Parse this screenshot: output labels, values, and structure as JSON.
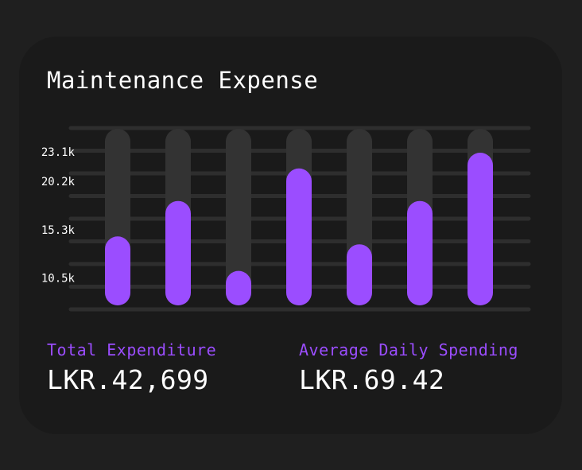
{
  "title": "Maintenance Expense",
  "stats": {
    "total_label": "Total Expenditure",
    "total_value": "LKR.42,699",
    "avg_label": "Average Daily Spending",
    "avg_value": "LKR.69.42"
  },
  "colors": {
    "accent": "#9b4dff",
    "track": "#333333",
    "grid": "#2e2e2e",
    "card": "#1a1a1a",
    "text": "#ffffff"
  },
  "chart_data": {
    "type": "bar",
    "categories": [
      "",
      "",
      "",
      "",
      "",
      "",
      ""
    ],
    "values": [
      15.6,
      19.2,
      12.1,
      22.5,
      14.8,
      19.2,
      24.1
    ],
    "ytick_labels": [
      "23.1k",
      "20.2k",
      "15.3k",
      "10.5k"
    ],
    "ytick_values": [
      24.1,
      21.1,
      16.2,
      11.3
    ],
    "ylim": [
      8.2,
      26.6
    ],
    "grid": true,
    "title": "Maintenance Expense"
  }
}
